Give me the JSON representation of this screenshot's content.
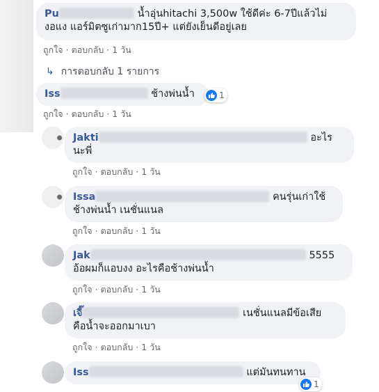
{
  "comments": [
    {
      "name": "Pu",
      "text_line1": "น้ำอุ่นhitachi 3,500w ใช้ดีค่ะ 6-7ปีแล้วไม่",
      "text_line2": "งอแง แอร์มิตซูเก่ามาก15ปี+ แต่ยังเย็นดีอยู่เลย",
      "like": "ถูกใจ",
      "reply": "ตอบกลับ",
      "time": "1 วัน"
    },
    {
      "name": "Iss",
      "text_line1": "ช้างพ่นน้ำ",
      "reaction_count": "1",
      "like": "ถูกใจ",
      "reply": "ตอบกลับ",
      "time": "1 วัน"
    }
  ],
  "view_replies": {
    "label": "การตอบกลับ 1 รายการ"
  },
  "replies": [
    {
      "name": "Jakti",
      "text_line1": "อะไร",
      "text_line2": "นะพี่",
      "like": "ถูกใจ",
      "reply": "ตอบกลับ",
      "time": "1 วัน"
    },
    {
      "name": "Issa",
      "text_line1": "คนรุ่นเก่าใช้",
      "text_line2": "ช้างพ่นน้ำ เนชั่นแนล",
      "like": "ถูกใจ",
      "reply": "ตอบกลับ",
      "time": "1 วัน"
    },
    {
      "name": "Jak",
      "text_line1": "5555",
      "text_line2": "อ้อผมก็แอบงง อะไรคือช้างพ่นน้ำ",
      "like": "ถูกใจ",
      "reply": "ตอบกลับ",
      "time": "1 วัน"
    },
    {
      "name": "เจี๊",
      "text_line1": "เนชั่นแนลมีข้อเสีย",
      "text_line2": "คือน้ำจะออกมาเบา",
      "like": "ถูกใจ",
      "reply": "ตอบกลับ",
      "time": "1 วัน"
    },
    {
      "name": "Iss",
      "text_line1": "แต่มันทนทาน",
      "reaction_count": "1"
    }
  ],
  "colors": {
    "name": "#385898",
    "bubble": "#f0f2f5",
    "meta": "#65676b",
    "like_blue": "#1877f2"
  },
  "icons": {
    "reply_arrow": "reply-arrow-icon",
    "like": "like-thumb-icon"
  }
}
